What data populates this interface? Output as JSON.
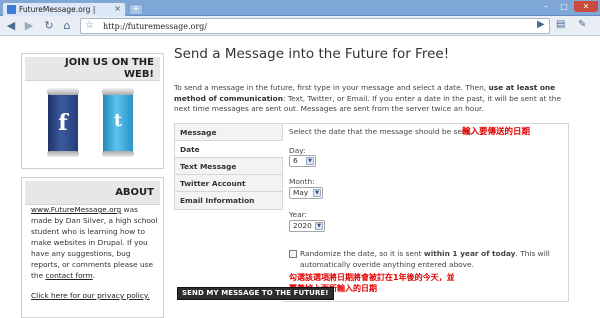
{
  "browser": {
    "tab_title": "FutureMessage.org |",
    "tab_close": "×",
    "new_tab": "+",
    "url": "http://futuremessage.org/",
    "win_min": "–",
    "win_max": "□",
    "win_close": "✕",
    "icons": [
      "back-icon",
      "forward-icon",
      "reload-icon",
      "home-icon",
      "star-icon",
      "go-icon",
      "page-menu-icon",
      "wrench-icon"
    ]
  },
  "sidebar": {
    "join_title": "JOIN US ON THE WEB!",
    "facebook_mark": "f",
    "twitter_mark": "t",
    "about_title": "ABOUT",
    "about_link": "www.FutureMessage.org",
    "about_text_1": " was made by Dan Silver, a high school student who is learning how to make websites in Drupal. If you have any suggestions, bug reports, or comments please use the ",
    "contact_link": "contact form",
    "about_text_2": ".",
    "privacy_link": "Click here for our privacy policy."
  },
  "main": {
    "title": "Send a Message into the Future for Free!",
    "intro_1": "To send a message in the future, first type in your message and select a date. Then, ",
    "intro_bold": "use at least one method of communication",
    "intro_2": ": Text, Twitter, or Email. If you enter a date in the past, it will be sent at the next time messages are sent out. Messages are sent from the server twice an hour.",
    "tabs": [
      "Message",
      "Date",
      "Text Message",
      "Twitter Account",
      "Email Information"
    ],
    "active_tab": "Date",
    "select_prompt": "Select the date that the message should be sent.",
    "annotation_top": "輸入要傳送的日期",
    "day_label": "Day:",
    "day_value": "6",
    "month_label": "Month:",
    "month_value": "May",
    "year_label": "Year:",
    "year_value": "2020",
    "randomize_1": "Randomize the date, so it is sent ",
    "randomize_bold": "within 1 year of today",
    "randomize_2": ". This will automatically overide anything entered above.",
    "annotation_bottom_1": "勾選該選項將日期將會被訂在1年後的今天，並",
    "annotation_bottom_2": "覆蓋掉上面所輸入的日期",
    "submit_label": "SEND MY MESSAGE TO THE FUTURE!"
  },
  "colors": {
    "annotation_red": "#e00000",
    "facebook_blue": "#2d4a8a",
    "twitter_blue": "#39a7d8",
    "submit_bg": "#2d2d2d"
  }
}
